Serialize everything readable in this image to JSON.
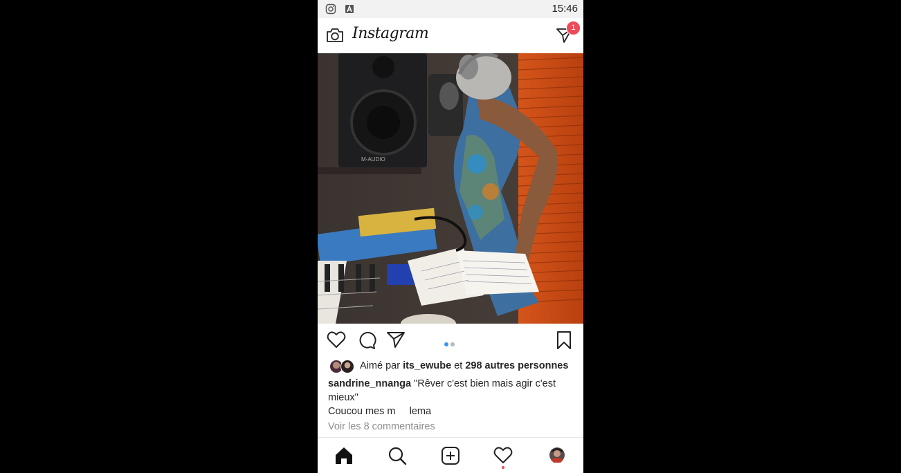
{
  "status_bar": {
    "time": "15:46",
    "icons": [
      "instagram-icon",
      "font-a-icon"
    ]
  },
  "header": {
    "logo": "Instagram",
    "dm_badge_count": "1"
  },
  "post": {
    "carousel_dots": 2,
    "carousel_active": 0,
    "likes": {
      "prefix": "Aimé par",
      "user": "its_ewube",
      "connector": "et",
      "others": "298 autres personnes"
    },
    "caption": {
      "username": "sandrine_nnanga",
      "text": "\"Rêver c'est bien mais agir c'est mieux\"",
      "second_line": "Coucou mes m     lema"
    },
    "view_comments": "Voir les 8 commentaires"
  },
  "bottom_nav": [
    "home-icon",
    "search-icon",
    "add-post-icon",
    "activity-heart-icon",
    "profile-avatar"
  ],
  "colors": {
    "accent_blue": "#3897f0",
    "badge_red": "#ed4956",
    "text": "#262626",
    "muted": "#8e8e8e"
  }
}
